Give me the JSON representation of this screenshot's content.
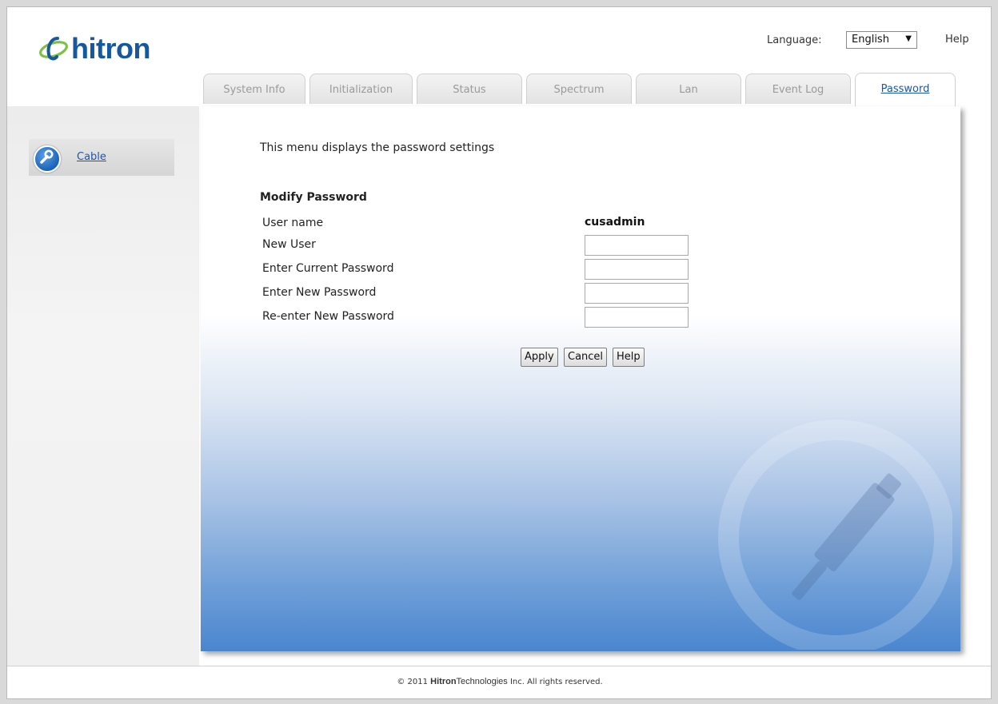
{
  "header": {
    "logo_text": "hitron",
    "language_label": "Language:",
    "language_value": "English",
    "help_link": "Help"
  },
  "sidebar": {
    "items": [
      {
        "label": "Cable",
        "icon": "wrench-icon"
      }
    ]
  },
  "tabs": [
    {
      "label": "System Info",
      "active": false
    },
    {
      "label": "Initialization",
      "active": false
    },
    {
      "label": "Status",
      "active": false
    },
    {
      "label": "Spectrum",
      "active": false
    },
    {
      "label": "Lan",
      "active": false
    },
    {
      "label": "Event Log",
      "active": false
    },
    {
      "label": "Password",
      "active": true
    }
  ],
  "main": {
    "intro": "This menu displays the password settings",
    "section_title": "Modify Password",
    "fields": {
      "user_name_label": "User name",
      "user_name_value": "cusadmin",
      "new_user_label": "New User",
      "new_user_value": "",
      "current_password_label": "Enter Current Password",
      "current_password_value": "",
      "new_password_label": "Enter New Password",
      "new_password_value": "",
      "reenter_password_label": "Re-enter New Password",
      "reenter_password_value": ""
    },
    "buttons": {
      "apply": "Apply",
      "cancel": "Cancel",
      "help": "Help"
    }
  },
  "footer": {
    "prefix": "© 2011",
    "brand_bold": "Hitron",
    "brand_rest": "Technologies",
    "suffix": "Inc.  All rights reserved."
  },
  "colors": {
    "brand_blue": "#15589f",
    "link_blue": "#1a56b0",
    "panel_gradient_bottom": "#4a86cf"
  }
}
